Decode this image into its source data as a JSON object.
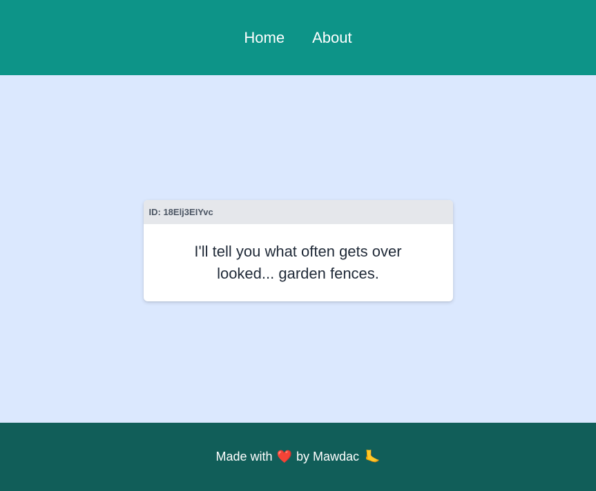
{
  "nav": {
    "home_label": "Home",
    "about_label": "About"
  },
  "card": {
    "id_label": "ID: 18Elj3EIYvc",
    "joke_text": "I'll tell you what often gets over looked... garden fences."
  },
  "footer": {
    "made_with": "Made with",
    "heart_glyph": "❤️",
    "by_text": "by Mawdac",
    "foot_glyph": "🦶"
  },
  "colors": {
    "header_bg": "#0d9488",
    "main_bg": "#dbe8fe",
    "footer_bg": "#115e59"
  }
}
